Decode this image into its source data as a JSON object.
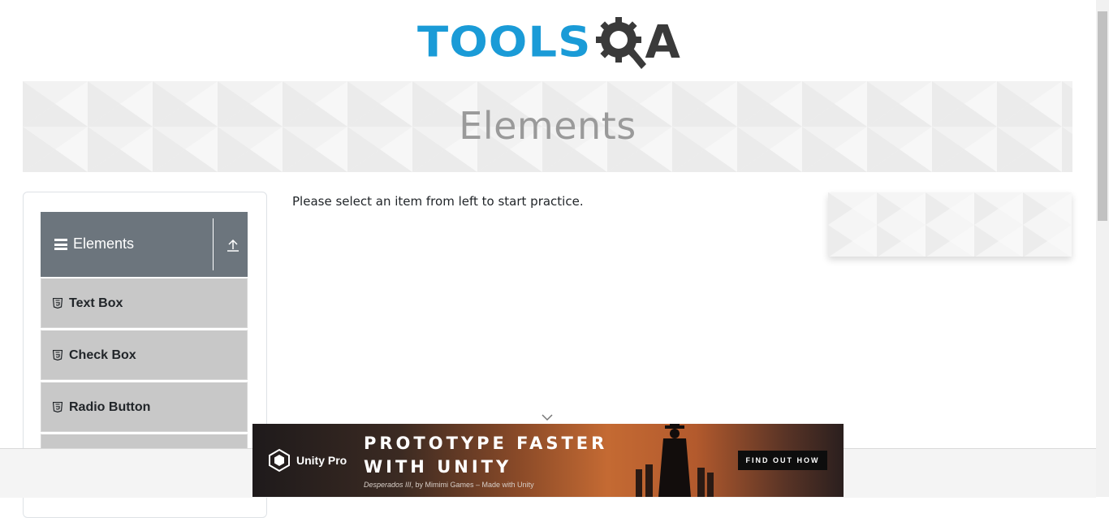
{
  "header": {
    "logo_text_tools": "TOOLS",
    "logo_text_a": "A",
    "logo_icon": "gear-magnifier-icon",
    "brand_color": "#1a9bd7"
  },
  "banner": {
    "title": "Elements"
  },
  "sidebar": {
    "group": {
      "title": "Elements",
      "menu_icon": "hamburger-icon",
      "collapse_icon": "collapse-up-icon"
    },
    "items": [
      {
        "label": "Text Box",
        "icon": "html5-icon"
      },
      {
        "label": "Check Box",
        "icon": "html5-icon"
      },
      {
        "label": "Radio Button",
        "icon": "html5-icon"
      }
    ],
    "header_color": "#6c757d",
    "item_color": "#c8c8c8"
  },
  "main": {
    "instruction": "Please select an item from left to start practice."
  },
  "ad": {
    "brand": "Unity Pro",
    "headline_line1": "PROTOTYPE FASTER",
    "headline_line2": "WITH UNITY",
    "caption_game": "Desperados III",
    "caption_rest": ", by Mimimi Games – Made with Unity",
    "cta": "FIND OUT HOW"
  }
}
